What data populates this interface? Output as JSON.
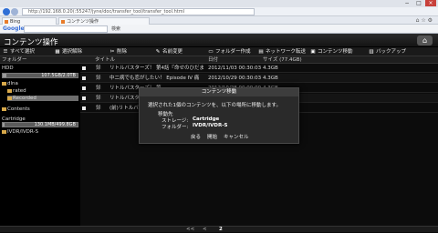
{
  "browser": {
    "url": "http://192.168.0.20(:55247/jyne/doc/transfer_tool/transfer_tool.html",
    "tab_label": "コンテンツ操作",
    "search_tab": "Bing",
    "google_logo": "Google",
    "google_search_btn": "検索",
    "window_controls": [
      "−",
      "□",
      "×"
    ]
  },
  "app": {
    "title": "コンテンツ操作",
    "toolbar": [
      {
        "icon": "list-icon",
        "label": "すべて選択"
      },
      {
        "icon": "unselect-icon",
        "label": "選択解除"
      },
      {
        "icon": "delete-icon",
        "label": "削除"
      },
      {
        "icon": "rename-icon",
        "label": "名前変更"
      },
      {
        "icon": "folder-icon",
        "label": "フォルダー作成"
      },
      {
        "icon": "network-icon",
        "label": "ネットワーク転送"
      },
      {
        "icon": "move-icon",
        "label": "コンテンツ移動"
      },
      {
        "icon": "backup-icon",
        "label": "バックアップ"
      }
    ],
    "columns": {
      "folder": "フォルダー",
      "title": "タイトル",
      "date": "日付",
      "size": "サイズ (77.4GB)"
    }
  },
  "left_pane": {
    "hdd_label": "HDD",
    "hdd_usage": "107.5GB/2.0TB",
    "hdd_fill": 0.05,
    "tree1": [
      "dlna",
      "rated",
      "Recorded"
    ],
    "contents_label": "Contents",
    "cartridge_label": "Cartridge",
    "cartridge_usage": "130.1MB/499.8GB",
    "cartridge_fill": 0.03,
    "tree2": [
      "IVDR/IVDR-S"
    ]
  },
  "rows": [
    {
      "icon": "録",
      "title": "リトルバスターズ！ 第4話『命せのひだま",
      "date": "2012/11/03 00:30:03",
      "size": "4.3GB"
    },
    {
      "icon": "録",
      "title": "中二病でも恋がしたい！ Episode IV 痛",
      "date": "2012/10/29 00:30:03",
      "size": "4.3GB"
    },
    {
      "icon": "録",
      "title": "リトルバスターズ！ 第",
      "date": "2012/10/28 00:00:00",
      "size": "4.3GB"
    },
    {
      "icon": "録",
      "title": "リトルバスターズ！",
      "date": "",
      "size": ""
    },
    {
      "icon": "録",
      "title": "(前)リトルバスター",
      "date": "",
      "size": ""
    }
  ],
  "dialog": {
    "title": "コンテンツ移動",
    "message": "選択された1個のコンテンツを、以下の場所に移動します。",
    "dest_heading": "移動先",
    "storage_label": "ストレージ:",
    "storage_value": "Cartridge",
    "folder_label": "フォルダー:",
    "folder_value": "IVDR/IVDR-S",
    "buttons": [
      "戻る",
      "開始",
      "キャンセル"
    ]
  },
  "pager": {
    "prev": "<<",
    "prev1": "<",
    "current": "2"
  }
}
